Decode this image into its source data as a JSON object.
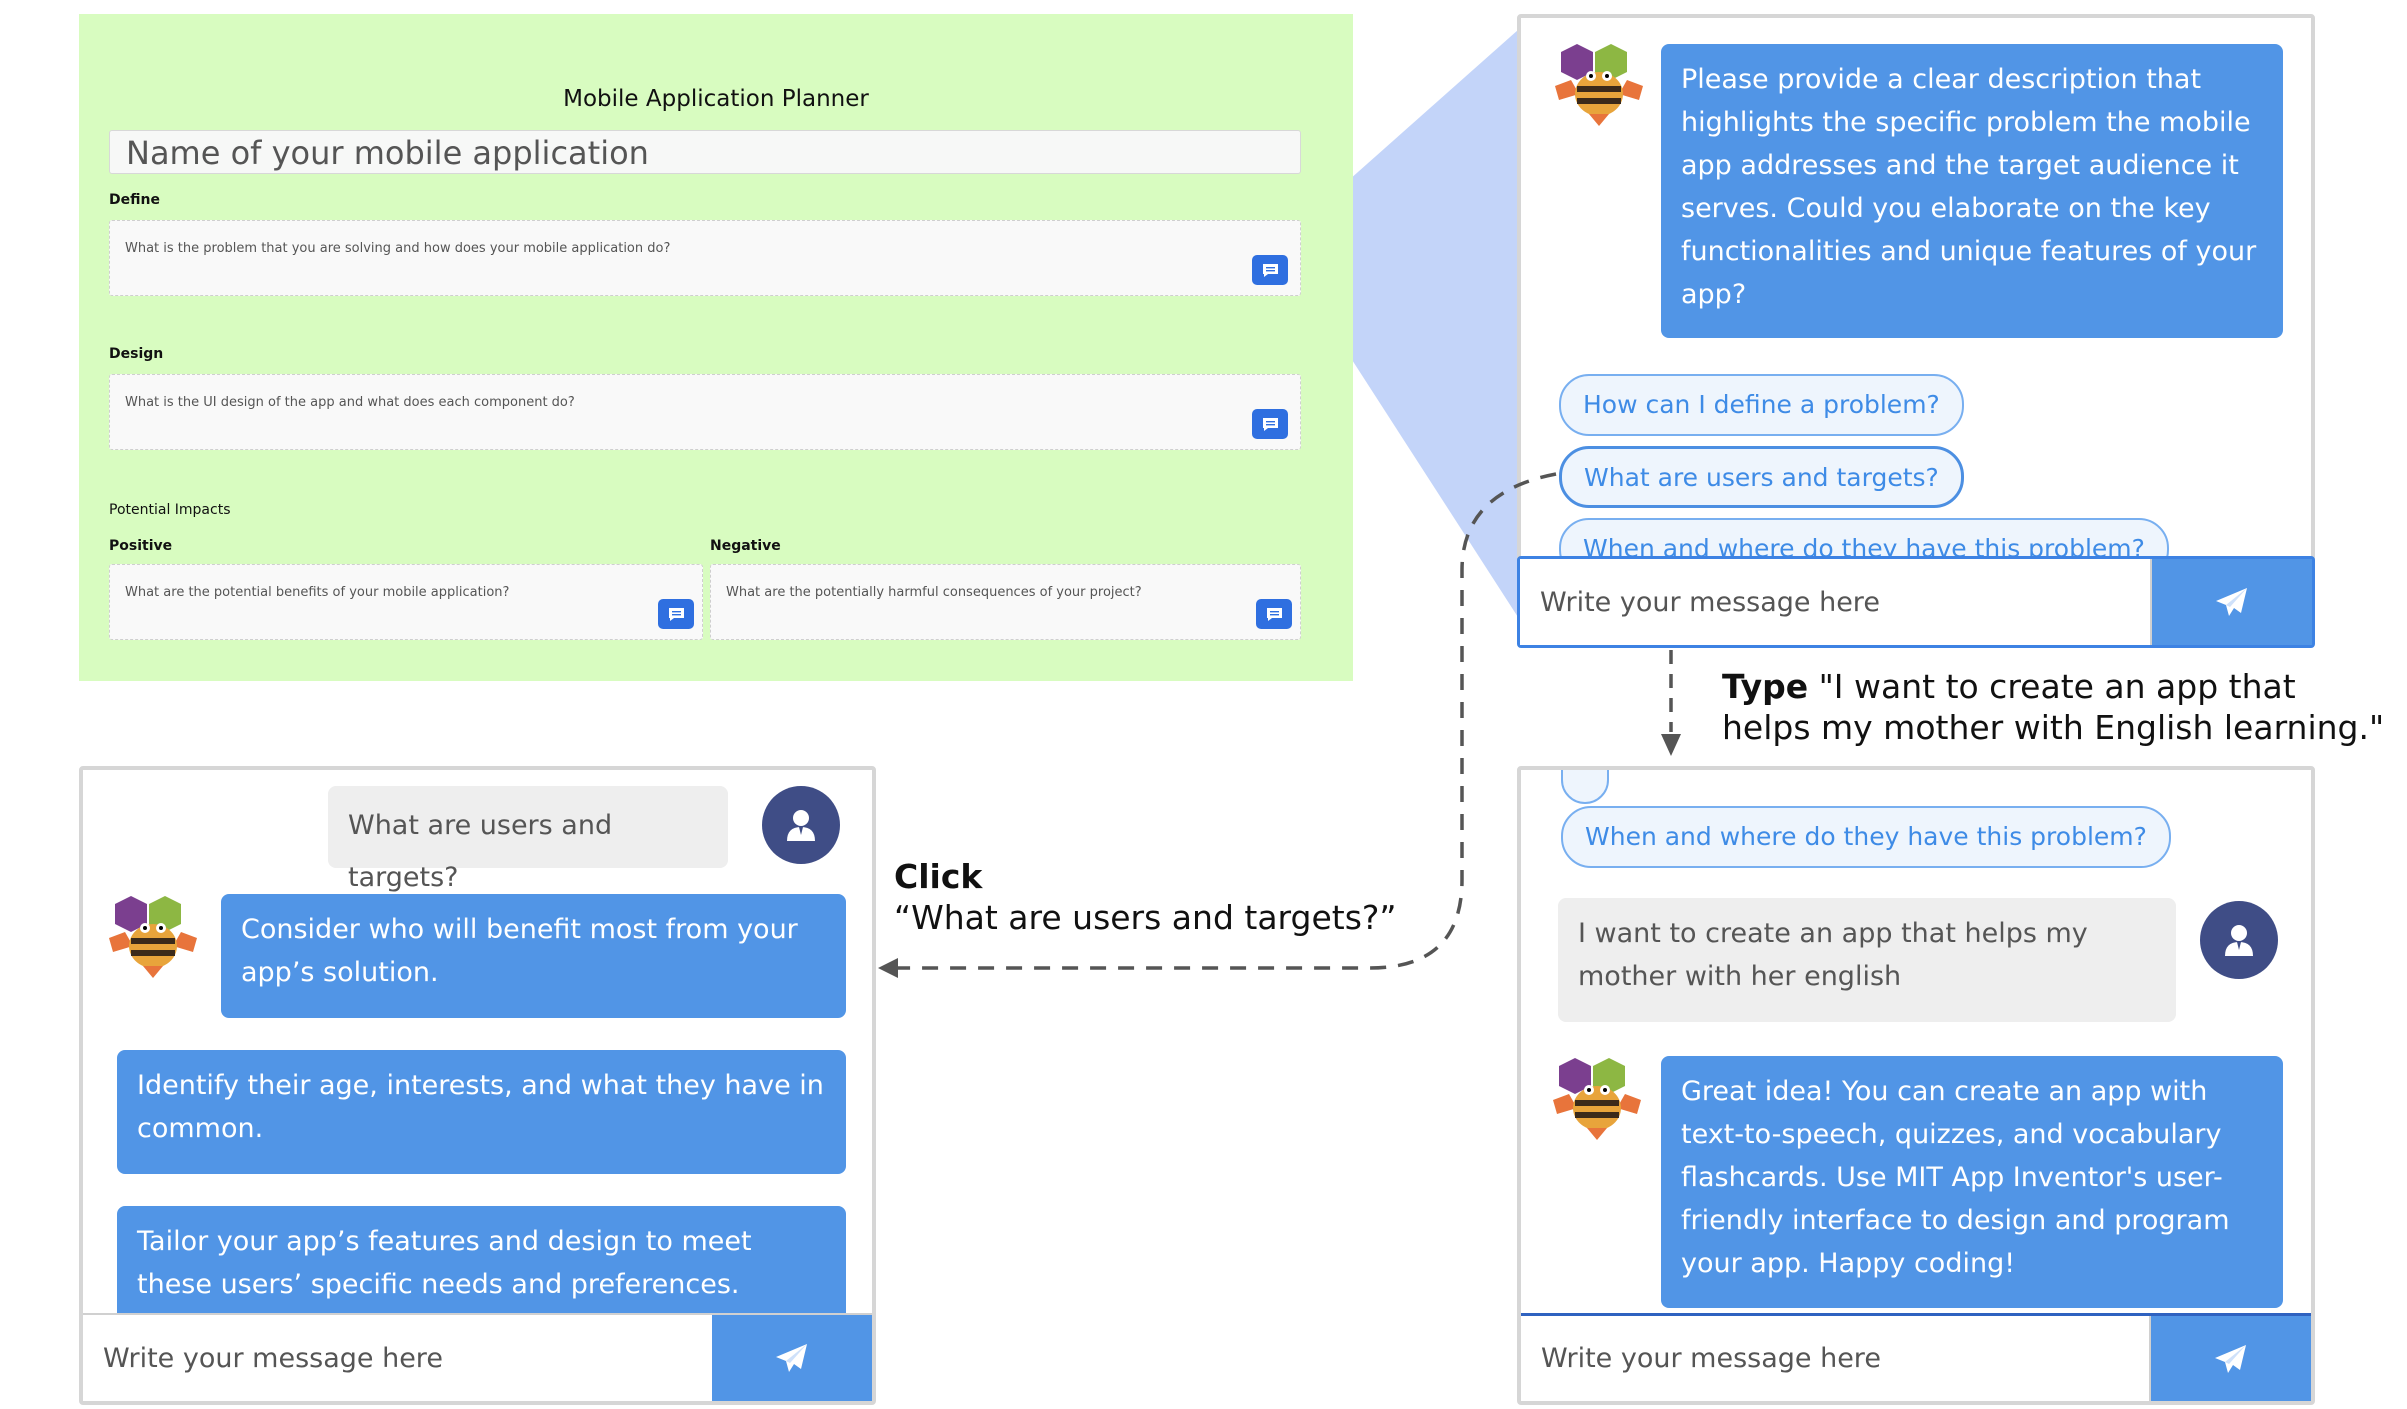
{
  "planner": {
    "title": "Mobile Application Planner",
    "name_placeholder": "Name of your mobile application",
    "define_label": "Define",
    "define_prompt": "What is the problem that you are solving and how does your mobile application do?",
    "design_label": "Design",
    "design_prompt": "What is the UI design of the app and what does each component do?",
    "impacts_label": "Potential Impacts",
    "positive_label": "Positive",
    "positive_prompt": "What are the potential benefits of your mobile application?",
    "negative_label": "Negative",
    "negative_prompt": "What are the potentially harmful consequences of your project?"
  },
  "chat_top": {
    "bot_message": "Please provide a clear description that highlights the specific problem the mobile app addresses and the target audience it serves. Could you elaborate on the key functionalities and unique features of your app?",
    "suggestions": [
      "How can I define a problem?",
      "What are users and targets?",
      "When and where do they have this problem?"
    ],
    "input_placeholder": "Write your message here"
  },
  "chat_left": {
    "user_message": "What are users and targets?",
    "bot_messages": [
      "Consider who will benefit most from your app’s solution.",
      "Identify their age, interests, and what they have in common.",
      "Tailor your app’s features and design to meet these users’ specific needs and preferences."
    ],
    "input_placeholder": "Write your message here"
  },
  "chat_right": {
    "suggestion": "When and where do they have this problem?",
    "user_message": "I want to create an app that helps my mother with her english",
    "bot_message": "Great idea! You can create an app with text-to-speech, quizzes, and vocabulary flashcards. Use MIT App Inventor's user-friendly interface to design and program your app. Happy coding!",
    "input_placeholder": "Write your message here"
  },
  "annotations": {
    "type_bold": "Type",
    "type_line1": "\"I want to create an app that",
    "type_line2": "helps my mother with English learning.\"",
    "click_bold": "Click",
    "click_text": "“What are users and targets?”"
  },
  "colors": {
    "planner_bg": "#d8fcc0",
    "accent_blue": "#5195e6",
    "planner_button": "#2f6fe0",
    "avatar_navy": "#3f4d86",
    "zoom_fill": "#b9cdf8"
  },
  "icons": [
    "chat-bubble-icon",
    "send-icon",
    "user-icon",
    "bee-bot-icon"
  ]
}
